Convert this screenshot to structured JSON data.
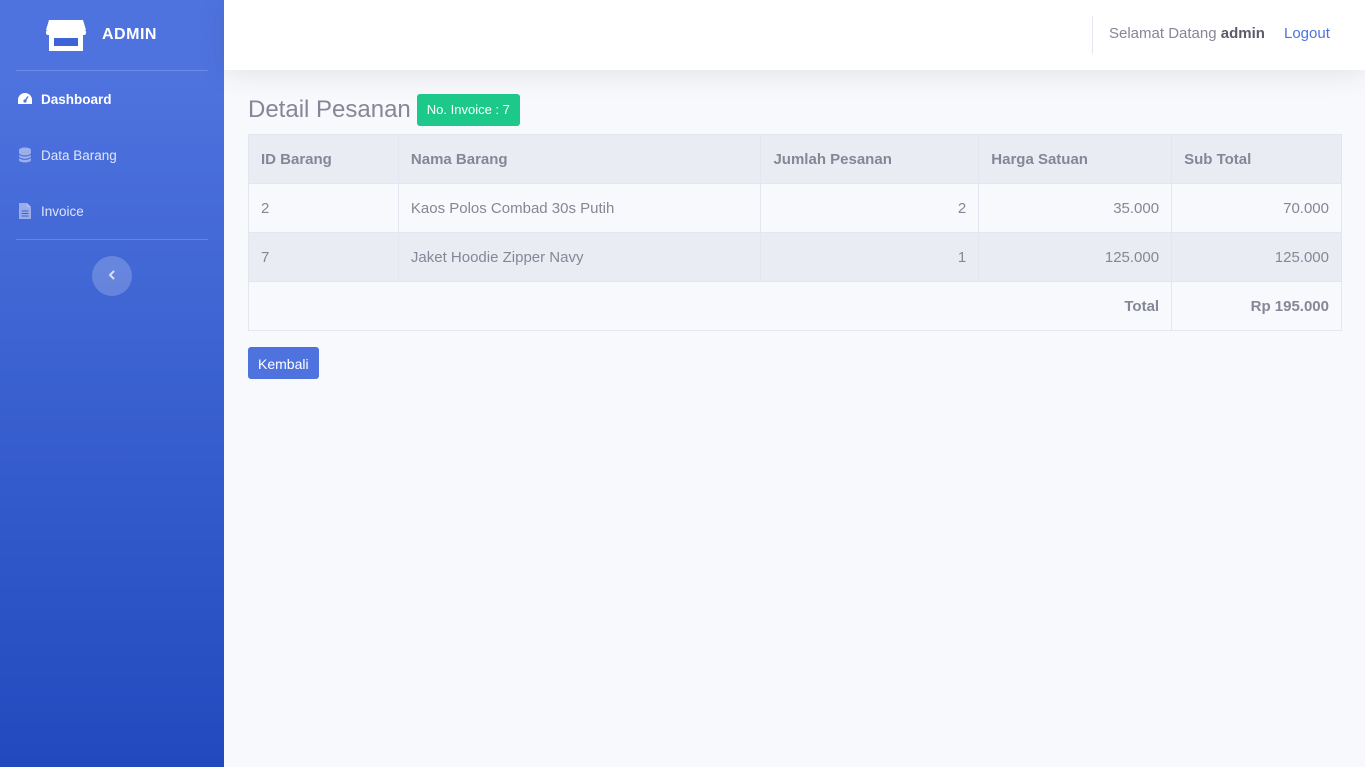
{
  "sidebar": {
    "brand": "ADMIN",
    "items": [
      {
        "label": "Dashboard",
        "icon": "dashboard-gauge-icon"
      },
      {
        "label": "Data Barang",
        "icon": "database-icon"
      },
      {
        "label": "Invoice",
        "icon": "file-icon"
      }
    ],
    "toggle_icon": "chevron-left-icon"
  },
  "topbar": {
    "welcome_prefix": "Selamat Datang",
    "username": "admin",
    "logout_label": "Logout"
  },
  "page": {
    "title": "Detail Pesanan",
    "invoice_badge": "No. Invoice : 7"
  },
  "table": {
    "headers": [
      "ID Barang",
      "Nama Barang",
      "Jumlah Pesanan",
      "Harga Satuan",
      "Sub Total"
    ],
    "rows": [
      [
        "2",
        "Kaos Polos Combad 30s Putih",
        "2",
        "35.000",
        "70.000"
      ],
      [
        "7",
        "Jaket Hoodie Zipper Navy",
        "1",
        "125.000",
        "125.000"
      ]
    ],
    "total_label": "Total",
    "total_value": "Rp 195.000"
  },
  "actions": {
    "back_label": "Kembali"
  },
  "colors": {
    "primary": "#4e73df",
    "success": "#1cc88a",
    "text": "#858796"
  }
}
